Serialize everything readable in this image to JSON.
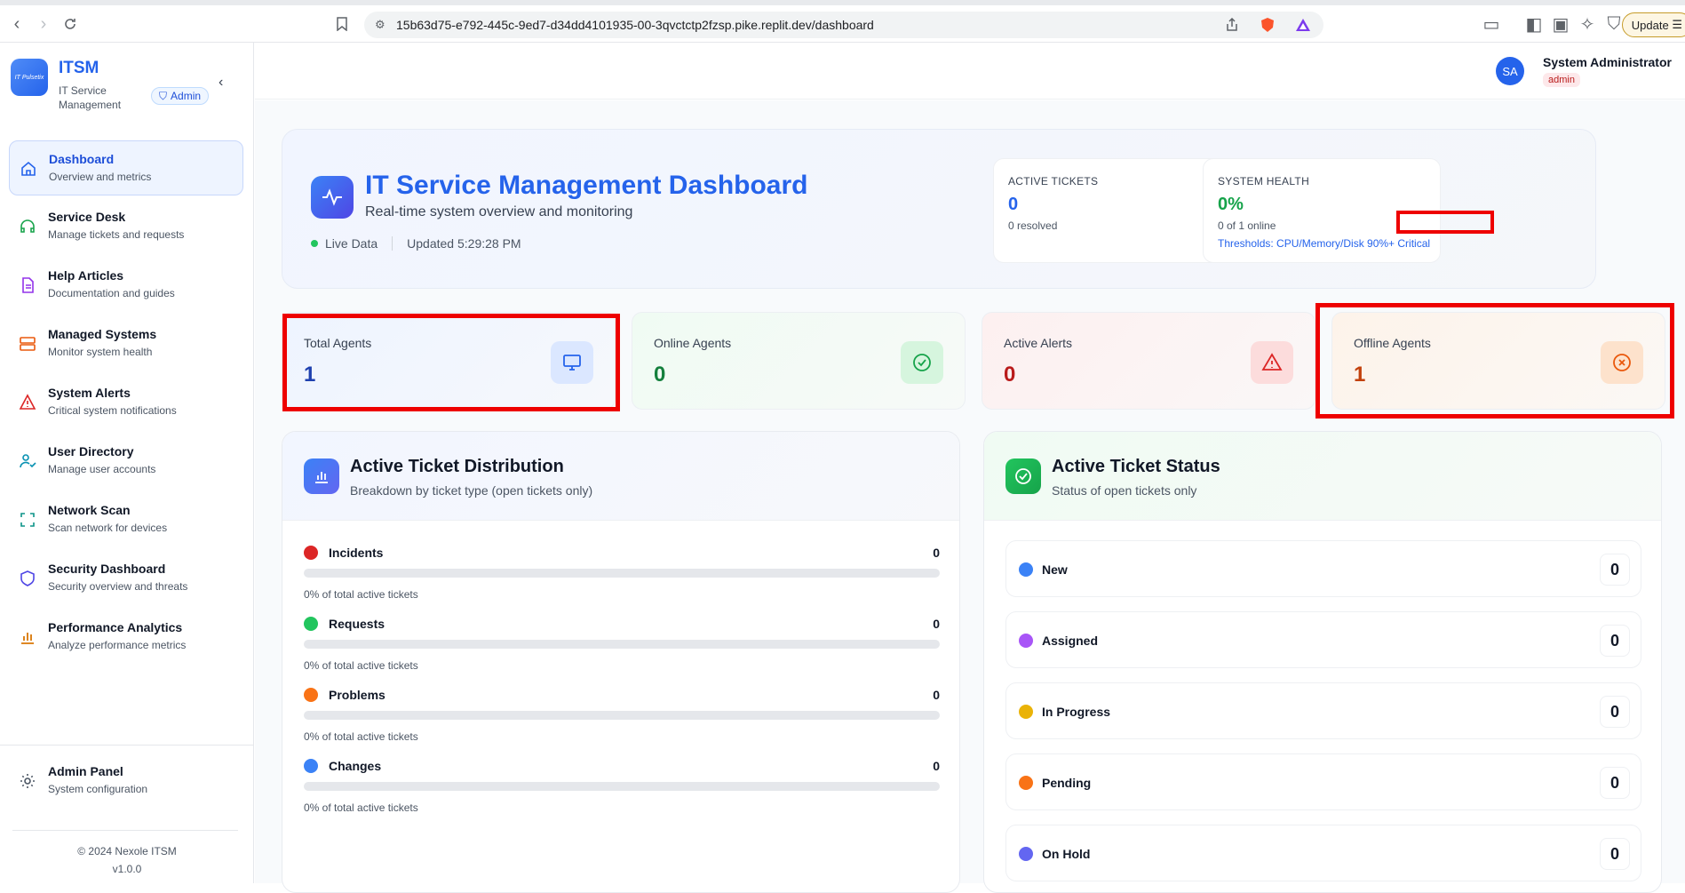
{
  "browser": {
    "url": "15b63d75-e792-445c-9ed7-d34dd4101935-00-3qvctctp2fzsp.pike.replit.dev/dashboard",
    "update_label": "Update"
  },
  "sidebar": {
    "logo_text": "IT Pulsetix",
    "title": "ITSM",
    "subtitle": "IT Service Management",
    "role_badge": "Admin",
    "items": [
      {
        "label": "Dashboard",
        "sub": "Overview and metrics",
        "icon": "home-icon"
      },
      {
        "label": "Service Desk",
        "sub": "Manage tickets and requests",
        "icon": "headset-icon"
      },
      {
        "label": "Help Articles",
        "sub": "Documentation and guides",
        "icon": "document-icon"
      },
      {
        "label": "Managed Systems",
        "sub": "Monitor system health",
        "icon": "server-icon"
      },
      {
        "label": "System Alerts",
        "sub": "Critical system notifications",
        "icon": "warning-icon"
      },
      {
        "label": "User Directory",
        "sub": "Manage user accounts",
        "icon": "user-check-icon"
      },
      {
        "label": "Network Scan",
        "sub": "Scan network for devices",
        "icon": "scan-icon"
      },
      {
        "label": "Security Dashboard",
        "sub": "Security overview and threats",
        "icon": "shield-icon"
      },
      {
        "label": "Performance Analytics",
        "sub": "Analyze performance metrics",
        "icon": "bar-chart-icon"
      }
    ],
    "admin_panel": {
      "label": "Admin Panel",
      "sub": "System configuration"
    },
    "copyright": "© 2024 Nexole ITSM",
    "version": "v1.0.0"
  },
  "user": {
    "initials": "SA",
    "name": "System Administrator",
    "role": "admin"
  },
  "hero": {
    "title": "IT Service Management Dashboard",
    "subtitle": "Real-time system overview and monitoring",
    "live_label": "Live Data",
    "updated": "Updated 5:29:28 PM",
    "active_tickets": {
      "label": "ACTIVE TICKETS",
      "value": "0",
      "sub": "0 resolved"
    },
    "system_health": {
      "label": "SYSTEM HEALTH",
      "value": "0%",
      "sub": "0 of 1 online",
      "thresholds": "Thresholds: CPU/Memory/Disk 90%+ Critical"
    }
  },
  "metrics": [
    {
      "label": "Total Agents",
      "value": "1",
      "color": "#1e40af",
      "icon": "monitor-icon"
    },
    {
      "label": "Online Agents",
      "value": "0",
      "color": "#15803d",
      "icon": "check-circle-icon"
    },
    {
      "label": "Active Alerts",
      "value": "0",
      "color": "#b91c1c",
      "icon": "alert-triangle-icon"
    },
    {
      "label": "Offline Agents",
      "value": "1",
      "color": "#c2410c",
      "icon": "x-circle-icon"
    }
  ],
  "distribution": {
    "title": "Active Ticket Distribution",
    "subtitle": "Breakdown by ticket type (open tickets only)",
    "rows": [
      {
        "name": "Incidents",
        "count": "0",
        "pct_text": "0% of total active tickets",
        "pct": 0,
        "color": "#dc2626"
      },
      {
        "name": "Requests",
        "count": "0",
        "pct_text": "0% of total active tickets",
        "pct": 0,
        "color": "#22c55e"
      },
      {
        "name": "Problems",
        "count": "0",
        "pct_text": "0% of total active tickets",
        "pct": 0,
        "color": "#f97316"
      },
      {
        "name": "Changes",
        "count": "0",
        "pct_text": "0% of total active tickets",
        "pct": 0,
        "color": "#3b82f6"
      }
    ]
  },
  "status": {
    "title": "Active Ticket Status",
    "subtitle": "Status of open tickets only",
    "rows": [
      {
        "name": "New",
        "count": "0",
        "color": "#3b82f6"
      },
      {
        "name": "Assigned",
        "count": "0",
        "color": "#a855f7"
      },
      {
        "name": "In Progress",
        "count": "0",
        "color": "#eab308"
      },
      {
        "name": "Pending",
        "count": "0",
        "color": "#f97316"
      },
      {
        "name": "On Hold",
        "count": "0",
        "color": "#6366f1"
      }
    ]
  }
}
